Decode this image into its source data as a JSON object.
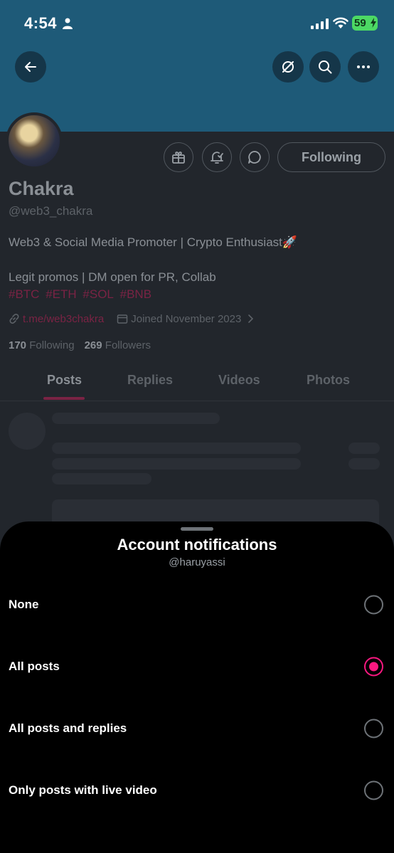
{
  "status_bar": {
    "time": "4:54",
    "battery": "59"
  },
  "profile": {
    "display_name": "Chakra",
    "handle": "@web3_chakra",
    "bio_line1": "Web3 & Social Media Promoter | Crypto Enthusiast🚀",
    "bio_line2": "Legit promos | DM open for PR, Collab",
    "hashtags": [
      "#BTC",
      "#ETH",
      "#SOL",
      "#BNB"
    ],
    "link": "t.me/web3chakra",
    "joined": "Joined November 2023",
    "following_count": "170",
    "following_label": "Following",
    "followers_count": "269",
    "followers_label": "Followers",
    "follow_button": "Following"
  },
  "tabs": [
    {
      "label": "Posts",
      "active": true
    },
    {
      "label": "Replies",
      "active": false
    },
    {
      "label": "Videos",
      "active": false
    },
    {
      "label": "Photos",
      "active": false
    }
  ],
  "sheet": {
    "title": "Account notifications",
    "subtitle": "@haruyassi",
    "options": [
      {
        "label": "None",
        "selected": false
      },
      {
        "label": "All posts",
        "selected": true
      },
      {
        "label": "All posts and replies",
        "selected": false
      },
      {
        "label": "Only posts with live video",
        "selected": false
      }
    ]
  },
  "colors": {
    "accent": "#f91880",
    "banner": "#1e5a78",
    "sheet_background": "#000000"
  },
  "icons": [
    "back-arrow-icon",
    "grok-icon",
    "search-icon",
    "more-icon",
    "gift-icon",
    "bell-icon",
    "message-icon",
    "link-icon",
    "calendar-icon",
    "chevron-right-icon"
  ]
}
